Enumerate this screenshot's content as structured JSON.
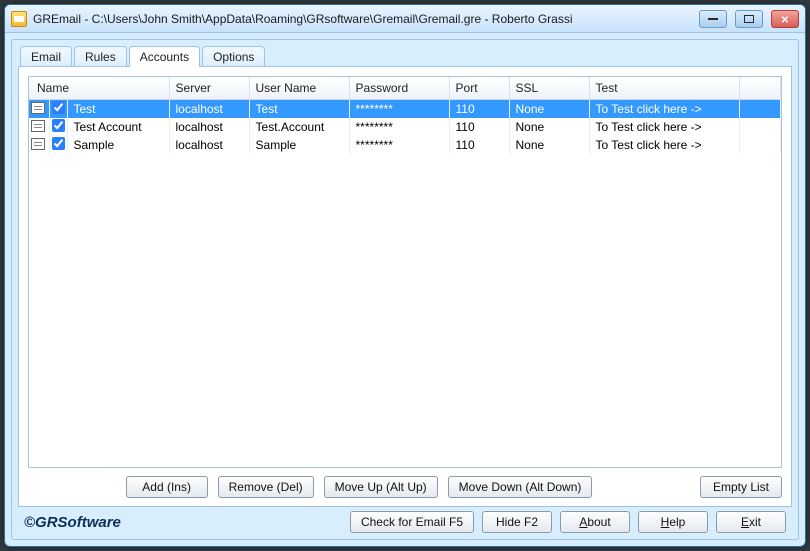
{
  "window": {
    "title": "GREmail - C:\\Users\\John Smith\\AppData\\Roaming\\GRsoftware\\Gremail\\Gremail.gre - Roberto Grassi"
  },
  "tabs": [
    {
      "label": "Email"
    },
    {
      "label": "Rules"
    },
    {
      "label": "Accounts"
    },
    {
      "label": "Options"
    }
  ],
  "active_tab_index": 2,
  "table": {
    "headers": {
      "name": "Name",
      "server": "Server",
      "user": "User Name",
      "password": "Password",
      "port": "Port",
      "ssl": "SSL",
      "test": "Test"
    },
    "rows": [
      {
        "checked": true,
        "name": "Test",
        "server": "localhost",
        "user": "Test",
        "password": "********",
        "port": "110",
        "ssl": "None",
        "test": "To Test click here ->",
        "selected": true
      },
      {
        "checked": true,
        "name": "Test Account",
        "server": "localhost",
        "user": "Test.Account",
        "password": "********",
        "port": "110",
        "ssl": "None",
        "test": "To Test click here ->",
        "selected": false
      },
      {
        "checked": true,
        "name": "Sample",
        "server": "localhost",
        "user": "Sample",
        "password": "********",
        "port": "110",
        "ssl": "None",
        "test": "To Test click here ->",
        "selected": false
      }
    ]
  },
  "buttons": {
    "add": "Add (Ins)",
    "remove": "Remove (Del)",
    "move_up": "Move Up (Alt Up)",
    "move_down": "Move Down (Alt Down)",
    "empty": "Empty List",
    "check": "Check for Email F5",
    "hide": "Hide F2",
    "about": "About",
    "help": "Help",
    "exit": "Exit"
  },
  "brand": "©GRSoftware"
}
